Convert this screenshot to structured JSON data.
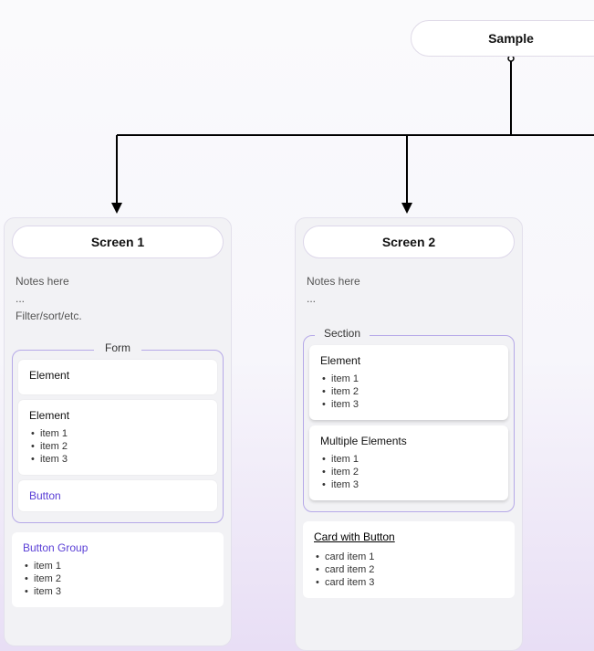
{
  "root": {
    "label": "Sample"
  },
  "screen1": {
    "title": "Screen 1",
    "notes": [
      "Notes here",
      "...",
      "Filter/sort/etc."
    ],
    "form": {
      "legend": "Form",
      "elements": [
        {
          "title": "Element",
          "items": []
        },
        {
          "title": "Element",
          "items": [
            "item 1",
            "item 2",
            "item 3"
          ]
        }
      ],
      "button": "Button"
    },
    "buttonGroup": {
      "title": "Button Group",
      "items": [
        "item 1",
        "item 2",
        "item 3"
      ]
    }
  },
  "screen2": {
    "title": "Screen 2",
    "notes": [
      "Notes here",
      "..."
    ],
    "section": {
      "legend": "Section",
      "elements": [
        {
          "title": "Element",
          "items": [
            "item 1",
            "item 2",
            "item 3"
          ]
        },
        {
          "title": "Multiple Elements",
          "items": [
            "item 1",
            "item 2",
            "item 3"
          ]
        }
      ]
    },
    "cardWithButton": {
      "title": "Card with Button",
      "items": [
        "card item 1",
        "card item 2",
        "card item 3"
      ]
    }
  }
}
